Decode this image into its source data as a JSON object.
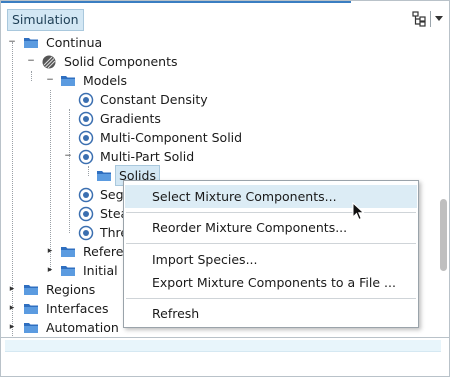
{
  "panel": {
    "title": "Simulation"
  },
  "tree": {
    "rows": [
      {
        "label": "Continua"
      },
      {
        "label": "Solid Components"
      },
      {
        "label": "Models"
      },
      {
        "label": "Constant Density"
      },
      {
        "label": "Gradients"
      },
      {
        "label": "Multi-Component Solid"
      },
      {
        "label": "Multi-Part Solid"
      },
      {
        "label": "Solids"
      },
      {
        "label": "Seg"
      },
      {
        "label": "Stea"
      },
      {
        "label": "Thre"
      },
      {
        "label": "Referen"
      },
      {
        "label": "Initial"
      },
      {
        "label": "Regions"
      },
      {
        "label": "Interfaces"
      },
      {
        "label": "Automation"
      }
    ]
  },
  "context_menu": {
    "items": [
      {
        "label": "Select Mixture Components..."
      },
      {
        "label": "Reorder Mixture Components..."
      },
      {
        "label": "Import Species..."
      },
      {
        "label": "Export Mixture Components to a File ..."
      },
      {
        "label": "Refresh"
      }
    ]
  },
  "colors": {
    "folder": "#2f6fc0",
    "model_icon": "#3b6fb0",
    "selection": "#d3e7f4",
    "menu_highlight": "#dcecf5"
  }
}
